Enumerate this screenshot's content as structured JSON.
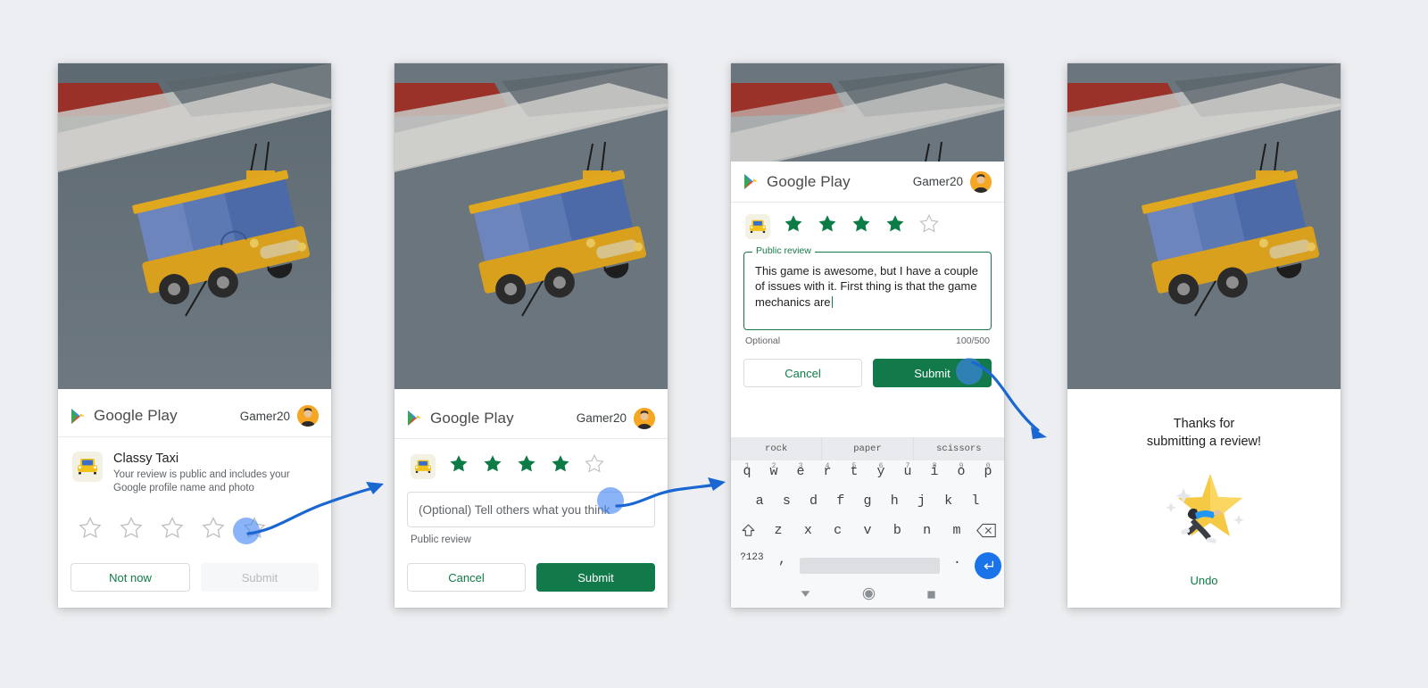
{
  "meta": {
    "page_background": "#eceef1",
    "accent_green": "#12794a",
    "accent_blue": "#1a73e8"
  },
  "brand": {
    "name": "Google Play",
    "user": "Gamer20"
  },
  "panel1": {
    "app_name": "Classy Taxi",
    "app_desc": "Your review is public and includes your Google profile name and photo",
    "stars_filled": 0,
    "stars_total": 5,
    "primary_label": "Submit",
    "secondary_label": "Not now"
  },
  "panel2": {
    "stars_filled": 4,
    "stars_total": 5,
    "input_placeholder": "(Optional) Tell others what you think",
    "helper_text": "Public review",
    "cancel_label": "Cancel",
    "submit_label": "Submit"
  },
  "panel3": {
    "stars_filled": 4,
    "stars_total": 5,
    "legend": "Public review",
    "review_text": "This game is awesome, but I have a couple of issues with it. First thing is that the game mechanics are",
    "optional_label": "Optional",
    "char_count": "100/500",
    "cancel_label": "Cancel",
    "submit_label": "Submit",
    "keyboard": {
      "suggestions": [
        "rock",
        "paper",
        "scissors"
      ],
      "row1": [
        {
          "key": "q",
          "num": "1"
        },
        {
          "key": "w",
          "num": "2"
        },
        {
          "key": "e",
          "num": "3"
        },
        {
          "key": "r",
          "num": "4"
        },
        {
          "key": "t",
          "num": "5"
        },
        {
          "key": "y",
          "num": "6"
        },
        {
          "key": "u",
          "num": "7"
        },
        {
          "key": "i",
          "num": "8"
        },
        {
          "key": "o",
          "num": "9"
        },
        {
          "key": "p",
          "num": "0"
        }
      ],
      "row2": [
        "a",
        "s",
        "d",
        "f",
        "g",
        "h",
        "j",
        "k",
        "l"
      ],
      "row3": [
        "z",
        "x",
        "c",
        "v",
        "b",
        "n",
        "m"
      ],
      "shift_icon": "shift-key-icon",
      "backspace_icon": "backspace-key-icon",
      "symbols_key": "?123",
      "comma_key": ",",
      "period_key": ".",
      "enter_icon": "enter-key-icon",
      "nav": [
        "back-nav-icon",
        "home-nav-icon",
        "recents-nav-icon"
      ]
    }
  },
  "panel4": {
    "thanks_line1": "Thanks for",
    "thanks_line2": "submitting a review!",
    "undo_label": "Undo",
    "illustration": "star-with-person-icon"
  }
}
